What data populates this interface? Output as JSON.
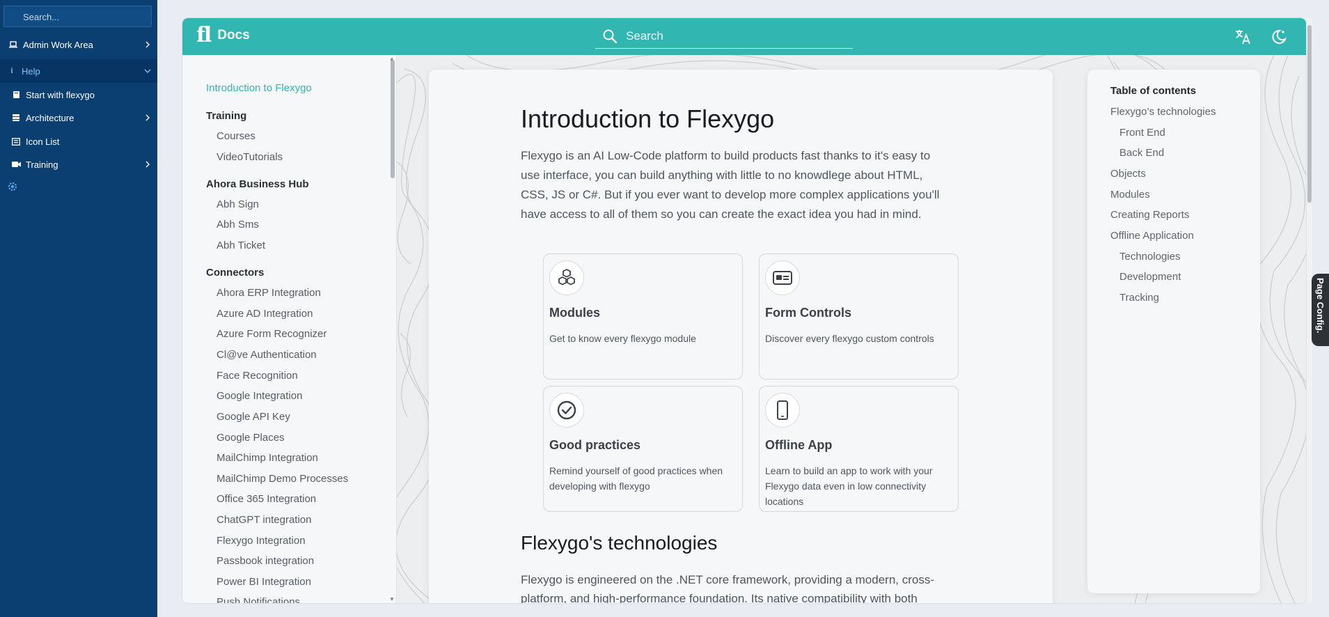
{
  "app_sidebar": {
    "search_placeholder": "Search...",
    "items": [
      {
        "label": "Admin Work Area",
        "icon": "laptop-icon",
        "indent": false
      },
      {
        "label": "Help",
        "icon": "info-icon",
        "indent": false
      },
      {
        "label": "Start with flexygo",
        "icon": "book-icon",
        "indent": true
      },
      {
        "label": "Architecture",
        "icon": "layers-icon",
        "indent": true
      },
      {
        "label": "Icon List",
        "icon": "list-icon",
        "indent": true
      },
      {
        "label": "Training",
        "icon": "video-icon",
        "indent": true
      }
    ]
  },
  "topbar": {
    "logo_mark": "fl",
    "brand": "Docs",
    "search_placeholder": "Search",
    "accent_color": "#31b6b1"
  },
  "docs_nav": {
    "active": "Introduction to Flexygo",
    "sections": [
      {
        "heading": "Training",
        "links": [
          "Courses",
          "VideoTutorials"
        ]
      },
      {
        "heading": "Ahora Business Hub",
        "links": [
          "Abh Sign",
          "Abh Sms",
          "Abh Ticket"
        ]
      },
      {
        "heading": "Connectors",
        "links": [
          "Ahora ERP Integration",
          "Azure AD Integration",
          "Azure Form Recognizer",
          "Cl@ve Authentication",
          "Face Recognition",
          "Google Integration",
          "Google API Key",
          "Google Places",
          "MailChimp Integration",
          "MailChimp Demo Processes",
          "Office 365 Integration",
          "ChatGPT integration",
          "Flexygo Integration",
          "Passbook integration",
          "Power BI Integration",
          "Push Notifications"
        ]
      }
    ]
  },
  "article": {
    "title": "Introduction to Flexygo",
    "intro": "Flexygo is an AI Low-Code platform to build products fast thanks to it's easy to use interface, you can build anything with little to no knowdlege about HTML, CSS, JS or C#. But if you ever want to develop more complex applications you'll have access to all of them so you can create the exact idea you had in mind.",
    "cards": [
      {
        "title": "Modules",
        "desc": "Get to know every flexygo module",
        "icon": "cubes-icon"
      },
      {
        "title": "Form Controls",
        "desc": "Discover every flexygo custom controls",
        "icon": "id-card-icon"
      },
      {
        "title": "Good practices",
        "desc": "Remind yourself of good practices when developing with flexygo",
        "icon": "check-circle-icon"
      },
      {
        "title": "Offline App",
        "desc": "Learn to build an app to work with your Flexygo data even in low connectivity locations",
        "icon": "mobile-icon"
      }
    ],
    "section_title": "Flexygo's technologies",
    "section_text": "Flexygo is engineered on the .NET core framework, providing a modern, cross-platform, and high-performance foundation. Its native compatibility with both"
  },
  "toc": {
    "heading": "Table of contents",
    "items": [
      {
        "label": "Flexygo’s technologies",
        "level": 1
      },
      {
        "label": "Front End",
        "level": 2
      },
      {
        "label": "Back End",
        "level": 2
      },
      {
        "label": "Objects",
        "level": 1
      },
      {
        "label": "Modules",
        "level": 1
      },
      {
        "label": "Creating Reports",
        "level": 1
      },
      {
        "label": "Offline Application",
        "level": 1
      },
      {
        "label": "Technologies",
        "level": 2
      },
      {
        "label": "Development",
        "level": 2
      },
      {
        "label": "Tracking",
        "level": 2
      }
    ]
  },
  "page_config": {
    "label": "Page Config."
  }
}
